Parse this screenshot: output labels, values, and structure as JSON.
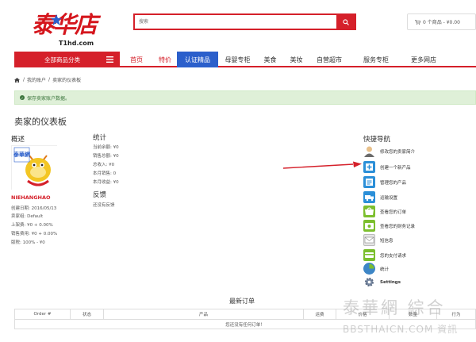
{
  "header": {
    "logo_cn": "泰华店",
    "logo_en": "T1hd.com",
    "search_placeholder": "搜索",
    "cart_text": "0 个商品 - ¥0.00"
  },
  "nav": {
    "all_categories": "全部商品分类",
    "items": [
      {
        "label": "首页"
      },
      {
        "label": "特价"
      },
      {
        "label": "认证精品"
      },
      {
        "label": "母婴专柜"
      },
      {
        "label": "美食"
      },
      {
        "label": "美妆"
      },
      {
        "label": "自营超市"
      },
      {
        "label": "服务专柜"
      },
      {
        "label": "更多网店"
      }
    ]
  },
  "breadcrumb": [
    "我的账户",
    "卖家的仪表板"
  ],
  "alert": "保存卖家账户数据。",
  "page_title": "卖家的仪表板",
  "overview": {
    "heading": "概述",
    "avatar_text": "泰華網",
    "seller_name": "NIEHANGHAO",
    "lines": [
      "创建日期: 2016/05/13",
      "卖家组: Default",
      "上架费: ¥0 + 0.00%",
      "销售费用: ¥0 + 0.00%",
      "版税: 100% - ¥0"
    ]
  },
  "stats": {
    "heading": "统计",
    "lines": [
      "当前余额: ¥0",
      "销售总额: ¥0",
      "总收入: ¥0",
      "本月销售: 0",
      "本月收益: ¥0"
    ],
    "feedback_heading": "反馈",
    "feedback_text": "还没有反馈"
  },
  "quick_nav": {
    "heading": "快捷导航",
    "items": [
      {
        "label": "修改您的卖家简介",
        "icon": "seller-profile-icon"
      },
      {
        "label": "创建一个新产品",
        "icon": "new-product-icon"
      },
      {
        "label": "管理您的产品",
        "icon": "manage-products-icon"
      },
      {
        "label": "运输设置",
        "icon": "shipping-icon"
      },
      {
        "label": "查看您的订单",
        "icon": "orders-icon"
      },
      {
        "label": "查看您的财务记录",
        "icon": "finance-icon"
      },
      {
        "label": "短信息",
        "icon": "mail-icon"
      },
      {
        "label": "您的支付请求",
        "icon": "payment-icon"
      },
      {
        "label": "统计",
        "icon": "stats-icon"
      },
      {
        "label": "Settings",
        "icon": "settings-icon"
      }
    ]
  },
  "orders": {
    "title": "最新订单",
    "columns": [
      "Order #",
      "状态",
      "产品",
      "运费",
      "价格",
      "数量",
      "行为"
    ],
    "empty": "您还没有任何订单！"
  },
  "watermark": {
    "cn": "泰華網 綜合",
    "en": "BBSTHAICN.COM 資訊"
  },
  "colors": {
    "brand_red": "#d5202a",
    "nav_active_blue": "#2b5fcb",
    "alert_green_bg": "#dff0d8"
  }
}
